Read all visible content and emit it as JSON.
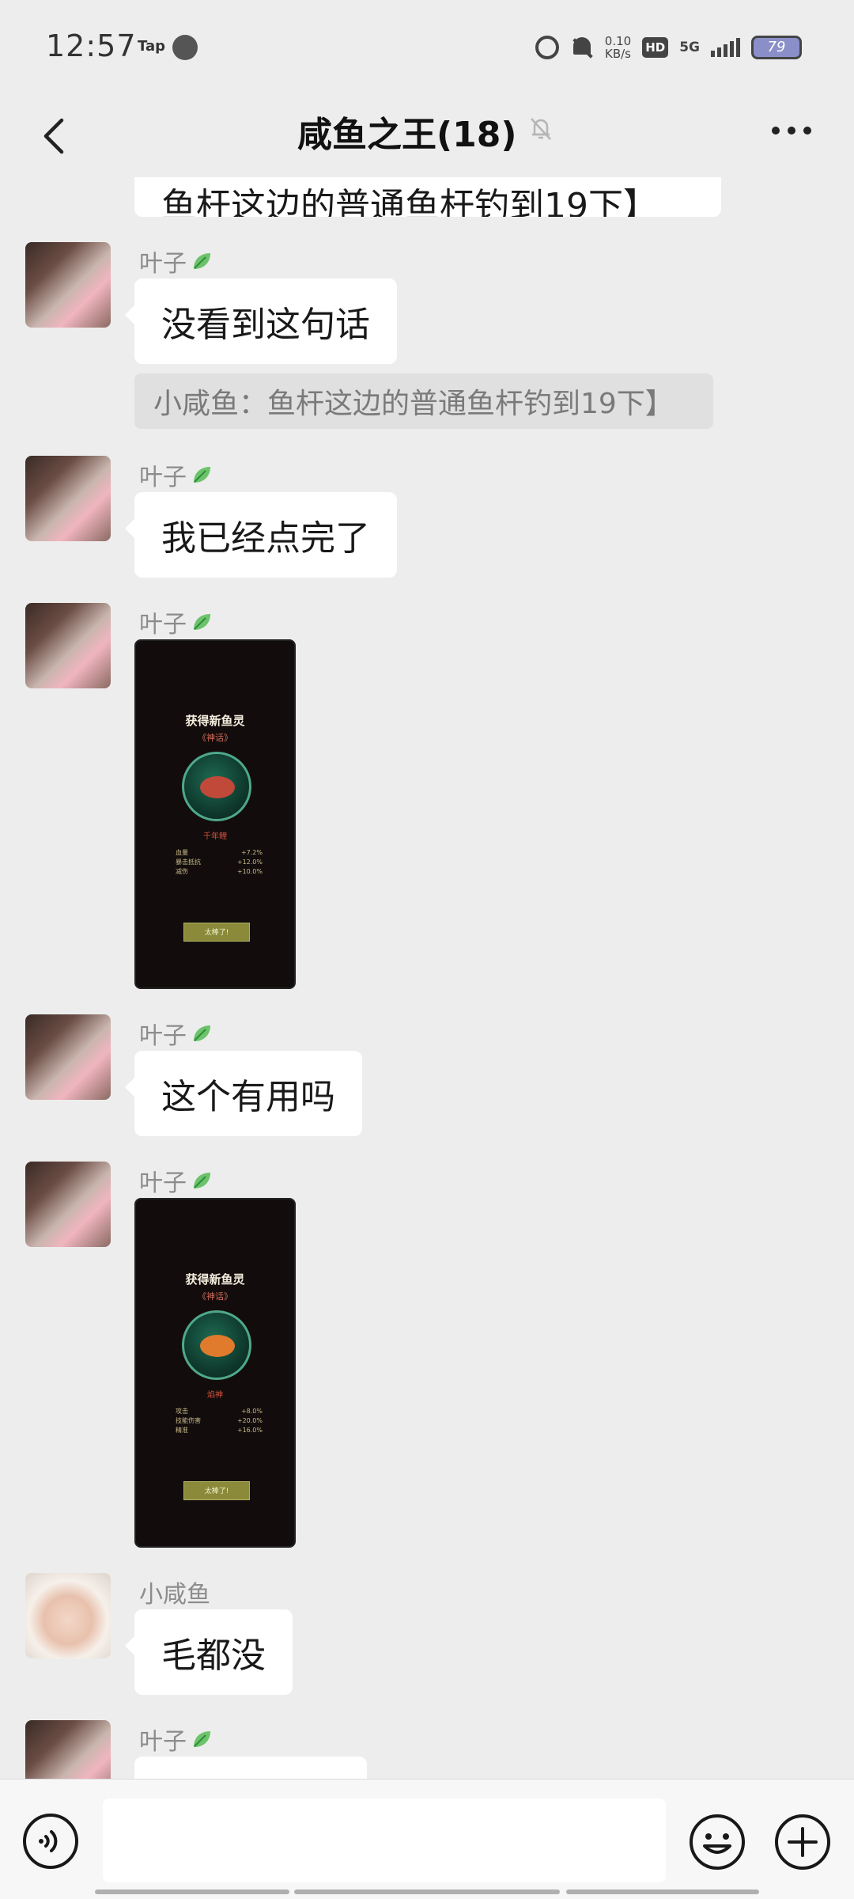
{
  "status_bar": {
    "time": "12:57",
    "tap_label": "Tap",
    "speed_value": "0.10",
    "speed_unit": "KB/s",
    "hd_label": "HD",
    "network": "5G",
    "battery": "79"
  },
  "header": {
    "title": "咸鱼之王(18)"
  },
  "messages": {
    "top_partial": "鱼杆这边的普通鱼杆钓到19下】",
    "m1": {
      "sender": "叶子",
      "text": "没看到这句话",
      "quote": "小咸鱼：鱼杆这边的普通鱼杆钓到19下】"
    },
    "m2": {
      "sender": "叶子",
      "text": "我已经点完了"
    },
    "m3": {
      "sender": "叶子",
      "image": {
        "title": "获得新鱼灵",
        "subtitle": "《神话》",
        "name": "千年鲤",
        "stats": [
          [
            "血量",
            "+7.2%"
          ],
          [
            "暴击抵抗",
            "+12.0%"
          ],
          [
            "减伤",
            "+10.0%"
          ]
        ],
        "button": "太棒了!"
      }
    },
    "m4": {
      "sender": "叶子",
      "text": "这个有用吗"
    },
    "m5": {
      "sender": "叶子",
      "image": {
        "title": "获得新鱼灵",
        "subtitle": "《神话》",
        "name": "焰神",
        "stats": [
          [
            "攻击",
            "+8.0%"
          ],
          [
            "技能伤害",
            "+20.0%"
          ],
          [
            "精准",
            "+16.0%"
          ]
        ],
        "button": "太棒了!"
      }
    },
    "m6": {
      "sender": "小咸鱼",
      "text": "毛都没"
    },
    "m7": {
      "sender": "叶子"
    }
  },
  "icons": {
    "back": "back-arrow-icon",
    "mute": "bell-off-icon",
    "more": "more-dots-icon",
    "leaf": "leaf-icon",
    "voice": "voice-icon",
    "emoji": "emoji-icon",
    "plus": "plus-icon"
  },
  "colors": {
    "background": "#ededed",
    "bubble": "#ffffff",
    "leaf_green": "#4caf50"
  }
}
